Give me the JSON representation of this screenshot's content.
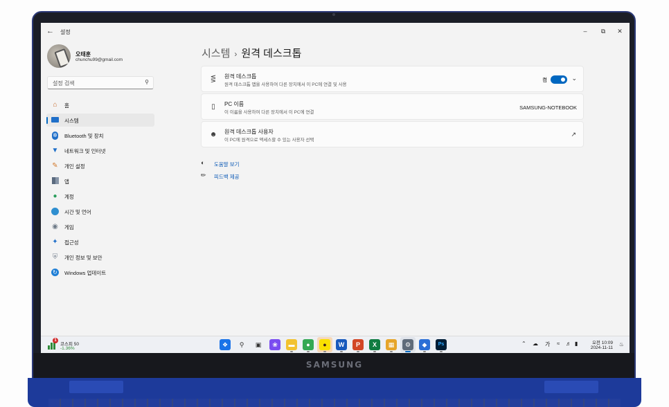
{
  "brand": "SAMSUNG",
  "window": {
    "title": "설정",
    "back": "←",
    "minimize": "–",
    "maximize": "⧉",
    "close": "✕"
  },
  "user": {
    "name": "오태훈",
    "email": "chunchu99@gmail.com"
  },
  "search": {
    "placeholder": "설정 검색"
  },
  "nav": [
    {
      "label": "홈",
      "icon": "home-icon"
    },
    {
      "label": "시스템",
      "icon": "system-icon",
      "active": true
    },
    {
      "label": "Bluetooth 및 장치",
      "icon": "bluetooth-icon"
    },
    {
      "label": "네트워크 및 인터넷",
      "icon": "network-icon"
    },
    {
      "label": "개인 설정",
      "icon": "brush-icon"
    },
    {
      "label": "앱",
      "icon": "apps-icon"
    },
    {
      "label": "계정",
      "icon": "account-icon"
    },
    {
      "label": "시간 및 언어",
      "icon": "globe-icon"
    },
    {
      "label": "게임",
      "icon": "gamepad-icon"
    },
    {
      "label": "접근성",
      "icon": "accessibility-icon"
    },
    {
      "label": "개인 정보 및 보안",
      "icon": "shield-icon"
    },
    {
      "label": "Windows 업데이트",
      "icon": "update-icon"
    }
  ],
  "page": {
    "breadcrumb_parent": "시스템",
    "separator": "›",
    "title": "원격 데스크톱"
  },
  "cards": {
    "remote_desktop": {
      "title": "원격 데스크톱",
      "desc": "원격 데스크톱 앱을 사용하여 다른 장치에서 이 PC에 연결 및 사용",
      "toggle_label": "켬",
      "toggle_on": true
    },
    "pc_name": {
      "title": "PC 이름",
      "desc": "이 이름을 사용하여 다른 장치에서 이 PC에 연결",
      "value": "SAMSUNG-NOTEBOOK"
    },
    "users": {
      "title": "원격 데스크톱 사용자",
      "desc": "이 PC에 원격으로 액세스할 수 있는 사용자 선택"
    }
  },
  "links": {
    "help": "도움말 보기",
    "feedback": "피드백 제공"
  },
  "taskbar": {
    "widget_name": "코스피 50",
    "widget_change": "-1.36%",
    "widget_badge": "1",
    "apps": [
      {
        "name": "start",
        "icon": "windows-icon",
        "color": "#1a73e8"
      },
      {
        "name": "search",
        "icon": "search-icon",
        "color": "#333333"
      },
      {
        "name": "task-view",
        "icon": "taskview-icon",
        "color": "#333333"
      },
      {
        "name": "copilot",
        "icon": "copilot-icon",
        "color": "#7a4cf0"
      },
      {
        "name": "explorer",
        "icon": "folder-icon",
        "color": "#f2c230"
      },
      {
        "name": "chrome",
        "icon": "chrome-icon",
        "color": "#34a853"
      },
      {
        "name": "kakaotalk",
        "icon": "chat-icon",
        "color": "#f9e000"
      },
      {
        "name": "word",
        "icon": "word-icon",
        "color": "#185abd"
      },
      {
        "name": "powerpoint",
        "icon": "powerpoint-icon",
        "color": "#d24726"
      },
      {
        "name": "excel",
        "icon": "excel-icon",
        "color": "#107c41"
      },
      {
        "name": "gallery",
        "icon": "gallery-icon",
        "color": "#e6a52a"
      },
      {
        "name": "settings",
        "icon": "gear-icon",
        "color": "#5f6b7a"
      },
      {
        "name": "defender",
        "icon": "shield-app-icon",
        "color": "#2b6fd6"
      },
      {
        "name": "photoshop",
        "icon": "photoshop-icon",
        "color": "#31a8ff"
      }
    ],
    "tray": {
      "ime": "가",
      "time": "오전 10:09",
      "date": "2024-11-11"
    }
  },
  "colors": {
    "accent": "#0067c0",
    "link": "#0a58b5",
    "laptop_blue": "#1d3a9a"
  }
}
